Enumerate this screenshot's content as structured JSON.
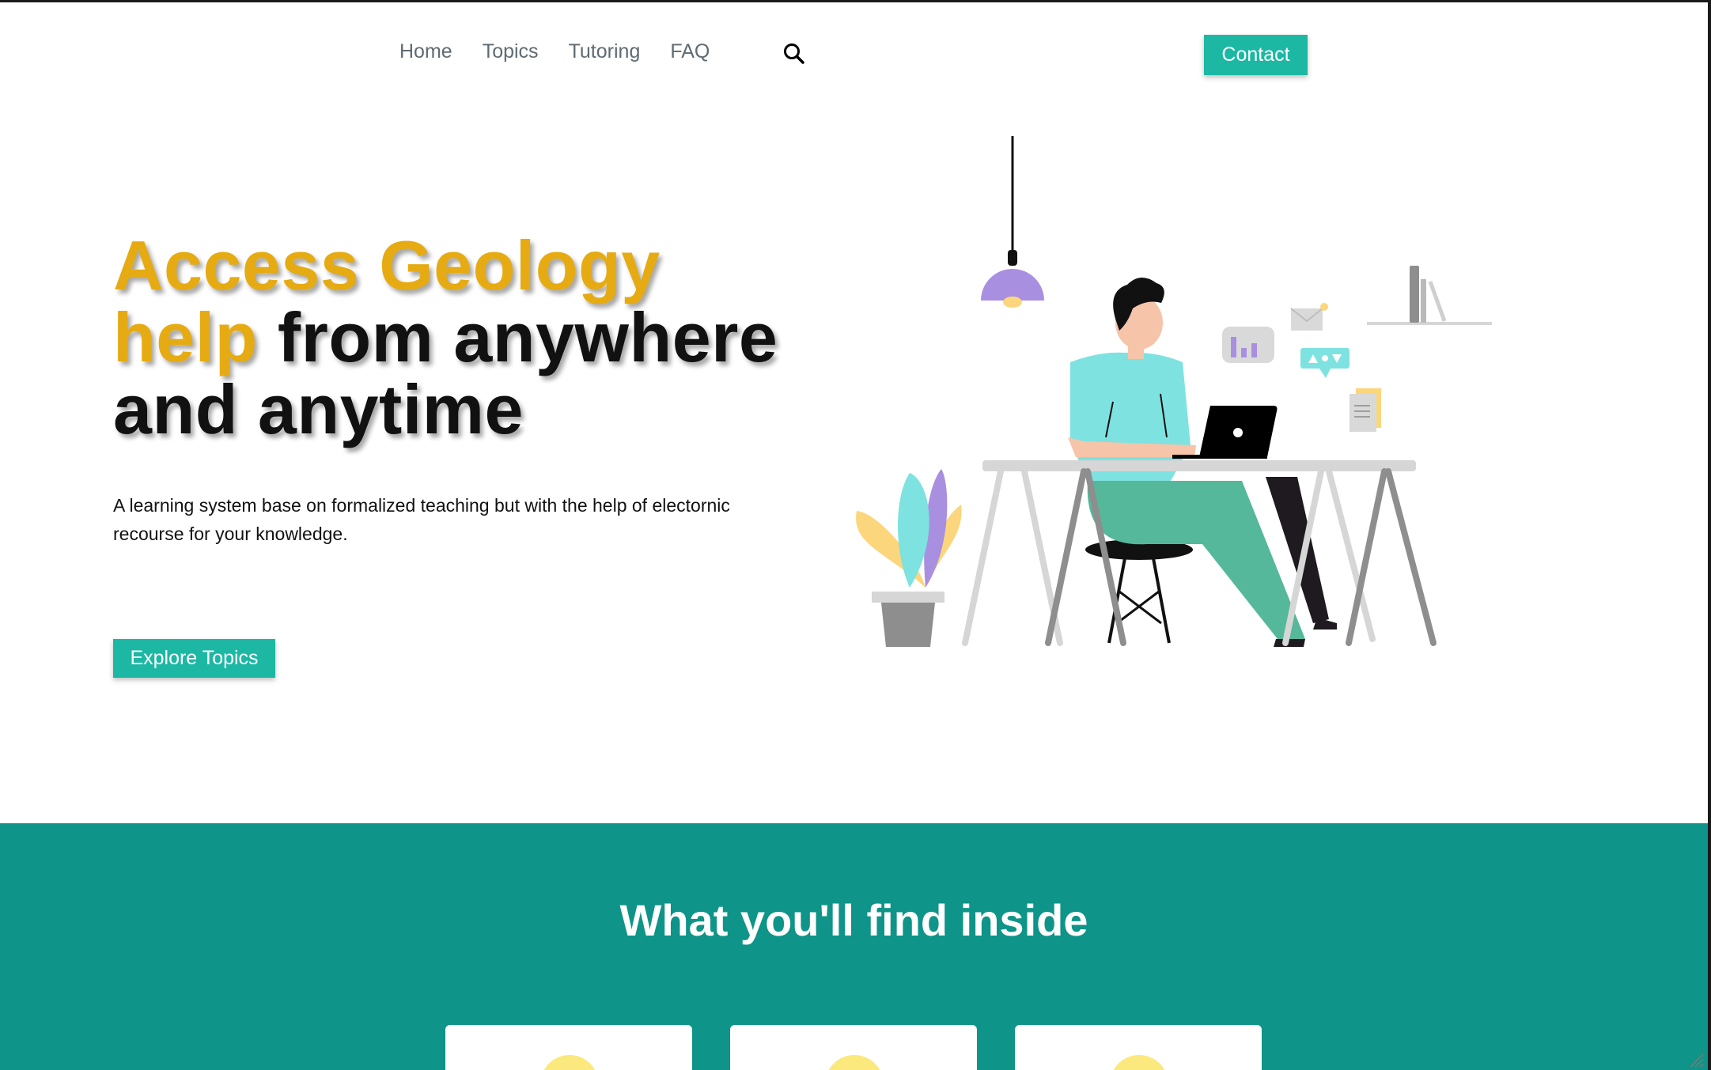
{
  "nav": {
    "links": [
      "Home",
      "Topics",
      "Tutoring",
      "FAQ"
    ],
    "search_icon": "search-icon",
    "contact_label": "Contact"
  },
  "hero": {
    "title_accent_1": "Access Geology",
    "title_accent_2": "help",
    "title_rest_1": " from anywhere",
    "title_rest_2": "and anytime",
    "description": "A learning system base on formalized teaching but with the help of electornic recourse for your knowledge.",
    "cta_label": "Explore Topics"
  },
  "features": {
    "title": "What you'll find inside",
    "card_count_visible": 3
  },
  "colors": {
    "accent_yellow": "#e6ab12",
    "brand_teal": "#1cb8a4",
    "section_teal": "#0e9488",
    "card_circle": "#fbe97d"
  }
}
